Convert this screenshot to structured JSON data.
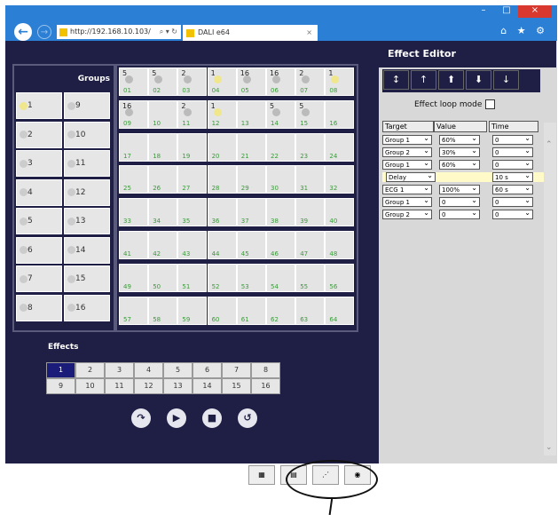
{
  "browser": {
    "url": "http://192.168.10.103/",
    "address_tools": "⌕ ▾ ↻",
    "tab_title": "DALI e64",
    "tab_close": "×",
    "icons": "⌂ ★ ⚙",
    "window_controls": [
      "–",
      "□",
      "×"
    ]
  },
  "groups": {
    "title": "Groups",
    "items": [
      "1",
      "9",
      "2",
      "10",
      "3",
      "11",
      "4",
      "12",
      "5",
      "13",
      "6",
      "14",
      "7",
      "15",
      "8",
      "16"
    ]
  },
  "ecg": {
    "cells": [
      {
        "n": "01",
        "g": "5",
        "on": false
      },
      {
        "n": "02",
        "g": "5",
        "on": false
      },
      {
        "n": "03",
        "g": "2",
        "on": false
      },
      {
        "n": "04",
        "g": "1",
        "on": true
      },
      {
        "n": "05",
        "g": "16",
        "on": false
      },
      {
        "n": "06",
        "g": "16",
        "on": false
      },
      {
        "n": "07",
        "g": "2",
        "on": false
      },
      {
        "n": "08",
        "g": "1",
        "on": true
      },
      {
        "n": "09",
        "g": "16",
        "on": false
      },
      {
        "n": "10",
        "g": "",
        "on": false
      },
      {
        "n": "11",
        "g": "2",
        "on": false
      },
      {
        "n": "12",
        "g": "1",
        "on": true
      },
      {
        "n": "13",
        "g": "",
        "on": false
      },
      {
        "n": "14",
        "g": "5",
        "on": false
      },
      {
        "n": "15",
        "g": "5",
        "on": false
      },
      {
        "n": "16",
        "g": "",
        "on": false
      },
      {
        "n": "17",
        "g": ""
      },
      {
        "n": "18",
        "g": ""
      },
      {
        "n": "19",
        "g": ""
      },
      {
        "n": "20",
        "g": ""
      },
      {
        "n": "21",
        "g": ""
      },
      {
        "n": "22",
        "g": ""
      },
      {
        "n": "23",
        "g": ""
      },
      {
        "n": "24",
        "g": ""
      },
      {
        "n": "25",
        "g": ""
      },
      {
        "n": "26",
        "g": ""
      },
      {
        "n": "27",
        "g": ""
      },
      {
        "n": "28",
        "g": ""
      },
      {
        "n": "29",
        "g": ""
      },
      {
        "n": "30",
        "g": ""
      },
      {
        "n": "31",
        "g": ""
      },
      {
        "n": "32",
        "g": ""
      },
      {
        "n": "33",
        "g": ""
      },
      {
        "n": "34",
        "g": ""
      },
      {
        "n": "35",
        "g": ""
      },
      {
        "n": "36",
        "g": ""
      },
      {
        "n": "37",
        "g": ""
      },
      {
        "n": "38",
        "g": ""
      },
      {
        "n": "39",
        "g": ""
      },
      {
        "n": "40",
        "g": ""
      },
      {
        "n": "41",
        "g": ""
      },
      {
        "n": "42",
        "g": ""
      },
      {
        "n": "43",
        "g": ""
      },
      {
        "n": "44",
        "g": ""
      },
      {
        "n": "45",
        "g": ""
      },
      {
        "n": "46",
        "g": ""
      },
      {
        "n": "47",
        "g": ""
      },
      {
        "n": "48",
        "g": ""
      },
      {
        "n": "49",
        "g": ""
      },
      {
        "n": "50",
        "g": ""
      },
      {
        "n": "51",
        "g": ""
      },
      {
        "n": "52",
        "g": ""
      },
      {
        "n": "53",
        "g": ""
      },
      {
        "n": "54",
        "g": ""
      },
      {
        "n": "55",
        "g": ""
      },
      {
        "n": "56",
        "g": ""
      },
      {
        "n": "57",
        "g": ""
      },
      {
        "n": "58",
        "g": ""
      },
      {
        "n": "59",
        "g": ""
      },
      {
        "n": "60",
        "g": ""
      },
      {
        "n": "61",
        "g": ""
      },
      {
        "n": "62",
        "g": ""
      },
      {
        "n": "63",
        "g": ""
      },
      {
        "n": "64",
        "g": ""
      }
    ]
  },
  "effects": {
    "title": "Effects",
    "items": [
      "1",
      "2",
      "3",
      "4",
      "5",
      "6",
      "7",
      "8",
      "9",
      "10",
      "11",
      "12",
      "13",
      "14",
      "15",
      "16"
    ],
    "active": "1"
  },
  "controls": [
    "↷",
    "▶",
    "■",
    "↺"
  ],
  "editor": {
    "title": "Effect Editor",
    "tools": [
      "↕",
      "↑",
      "⬆",
      "⬇",
      "↓"
    ],
    "loop_label": "Effect loop mode",
    "headers": [
      "Target",
      "Value",
      "Time"
    ],
    "rows": [
      {
        "target": "Group 1",
        "value": "60%",
        "time": "0"
      },
      {
        "target": "Group 2",
        "value": "30%",
        "time": "0"
      },
      {
        "target": "Group 1",
        "value": "60%",
        "time": "0"
      },
      {
        "target": "Delay",
        "value": "",
        "time": "10 s"
      },
      {
        "target": "ECG 1",
        "value": "100%",
        "time": "60 s"
      },
      {
        "target": "Group 1",
        "value": "0",
        "time": "0"
      },
      {
        "target": "Group 2",
        "value": "0",
        "time": "0"
      }
    ]
  },
  "scroll": {
    "up": "⌃",
    "down": "⌄"
  },
  "bottom_icons": [
    "▦",
    "▤",
    "⋰",
    "◉"
  ]
}
